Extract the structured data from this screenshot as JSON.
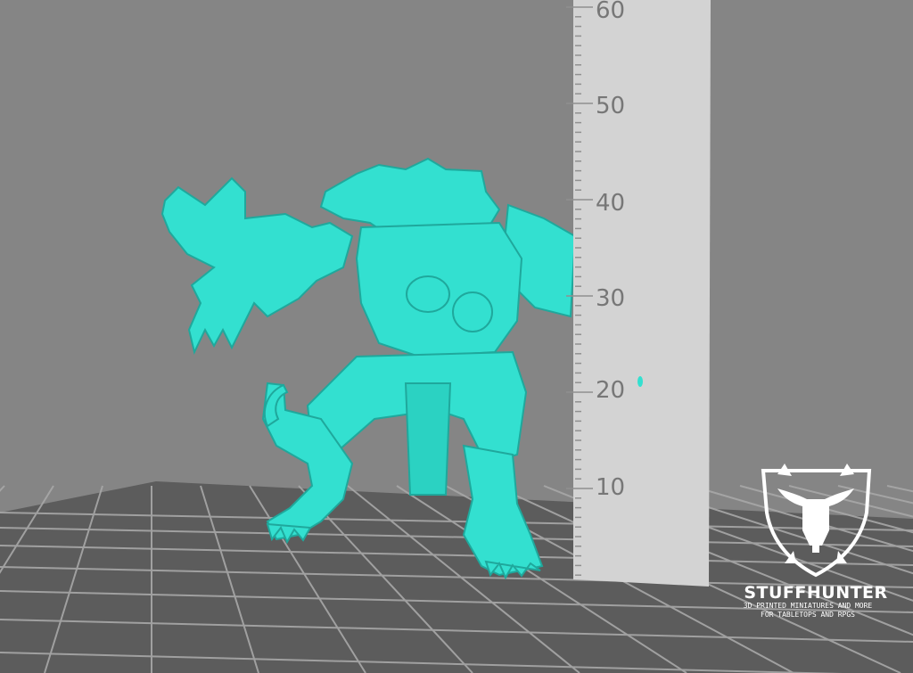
{
  "scene": {
    "background_color": "#858585",
    "floor_color": "#5c5c5c",
    "grid_color": "#a8a8a8",
    "model_color": "#33e0d0",
    "model_shadow_color": "#1fa89c",
    "ruler_color": "#d3d3d3"
  },
  "ruler": {
    "labels": [
      "60",
      "50",
      "40",
      "30",
      "20",
      "10"
    ]
  },
  "watermark": {
    "brand": "STUFFHUNTER",
    "tagline_1": "3D PRINTED MINIATURES AND MORE",
    "tagline_2": "FOR TABLETOPS AND RPGS",
    "logo_icon": "bull-skull-shield-icon"
  }
}
